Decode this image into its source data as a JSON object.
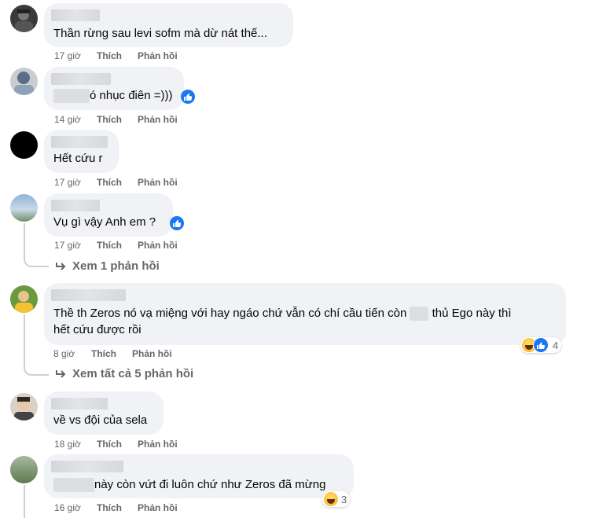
{
  "comments": [
    {
      "text": "Thần rừng sau levi sofm mà dừ nát thế...",
      "time": "17 giờ",
      "like": "Thích",
      "reply": "Phản hồi"
    },
    {
      "text_after": "ó nhục điên =)))",
      "time": "14 giờ",
      "like": "Thích",
      "reply": "Phản hồi"
    },
    {
      "text": "Hết cứu r",
      "time": "17 giờ",
      "like": "Thích",
      "reply": "Phản hồi"
    },
    {
      "text": "Vụ gì vậy Anh em ?",
      "time": "17 giờ",
      "like": "Thích",
      "reply": "Phản hồi",
      "view_replies": "Xem 1 phản hồi"
    },
    {
      "line1_before": "Thề th Zeros nó vạ miệng với hay ngáo chứ vẫn có chí cầu tiến còn",
      "line1_after": "thủ Ego này thì",
      "line2": "hết cứu được rồi",
      "time": "8 giờ",
      "like": "Thích",
      "reply": "Phản hồi",
      "reaction_count": "4",
      "view_replies": "Xem tất cả 5 phản hồi"
    },
    {
      "text": "về vs đội của sela",
      "time": "18 giờ",
      "like": "Thích",
      "reply": "Phản hồi"
    },
    {
      "text_after": "này còn vứt đi luôn chứ như Zeros đã mừng",
      "time": "16 giờ",
      "like": "Thích",
      "reply": "Phản hồi",
      "reaction_count": "3"
    }
  ],
  "colors": {
    "bubble": "#f0f2f5",
    "meta": "#65676b",
    "verified": "#1877f2"
  }
}
